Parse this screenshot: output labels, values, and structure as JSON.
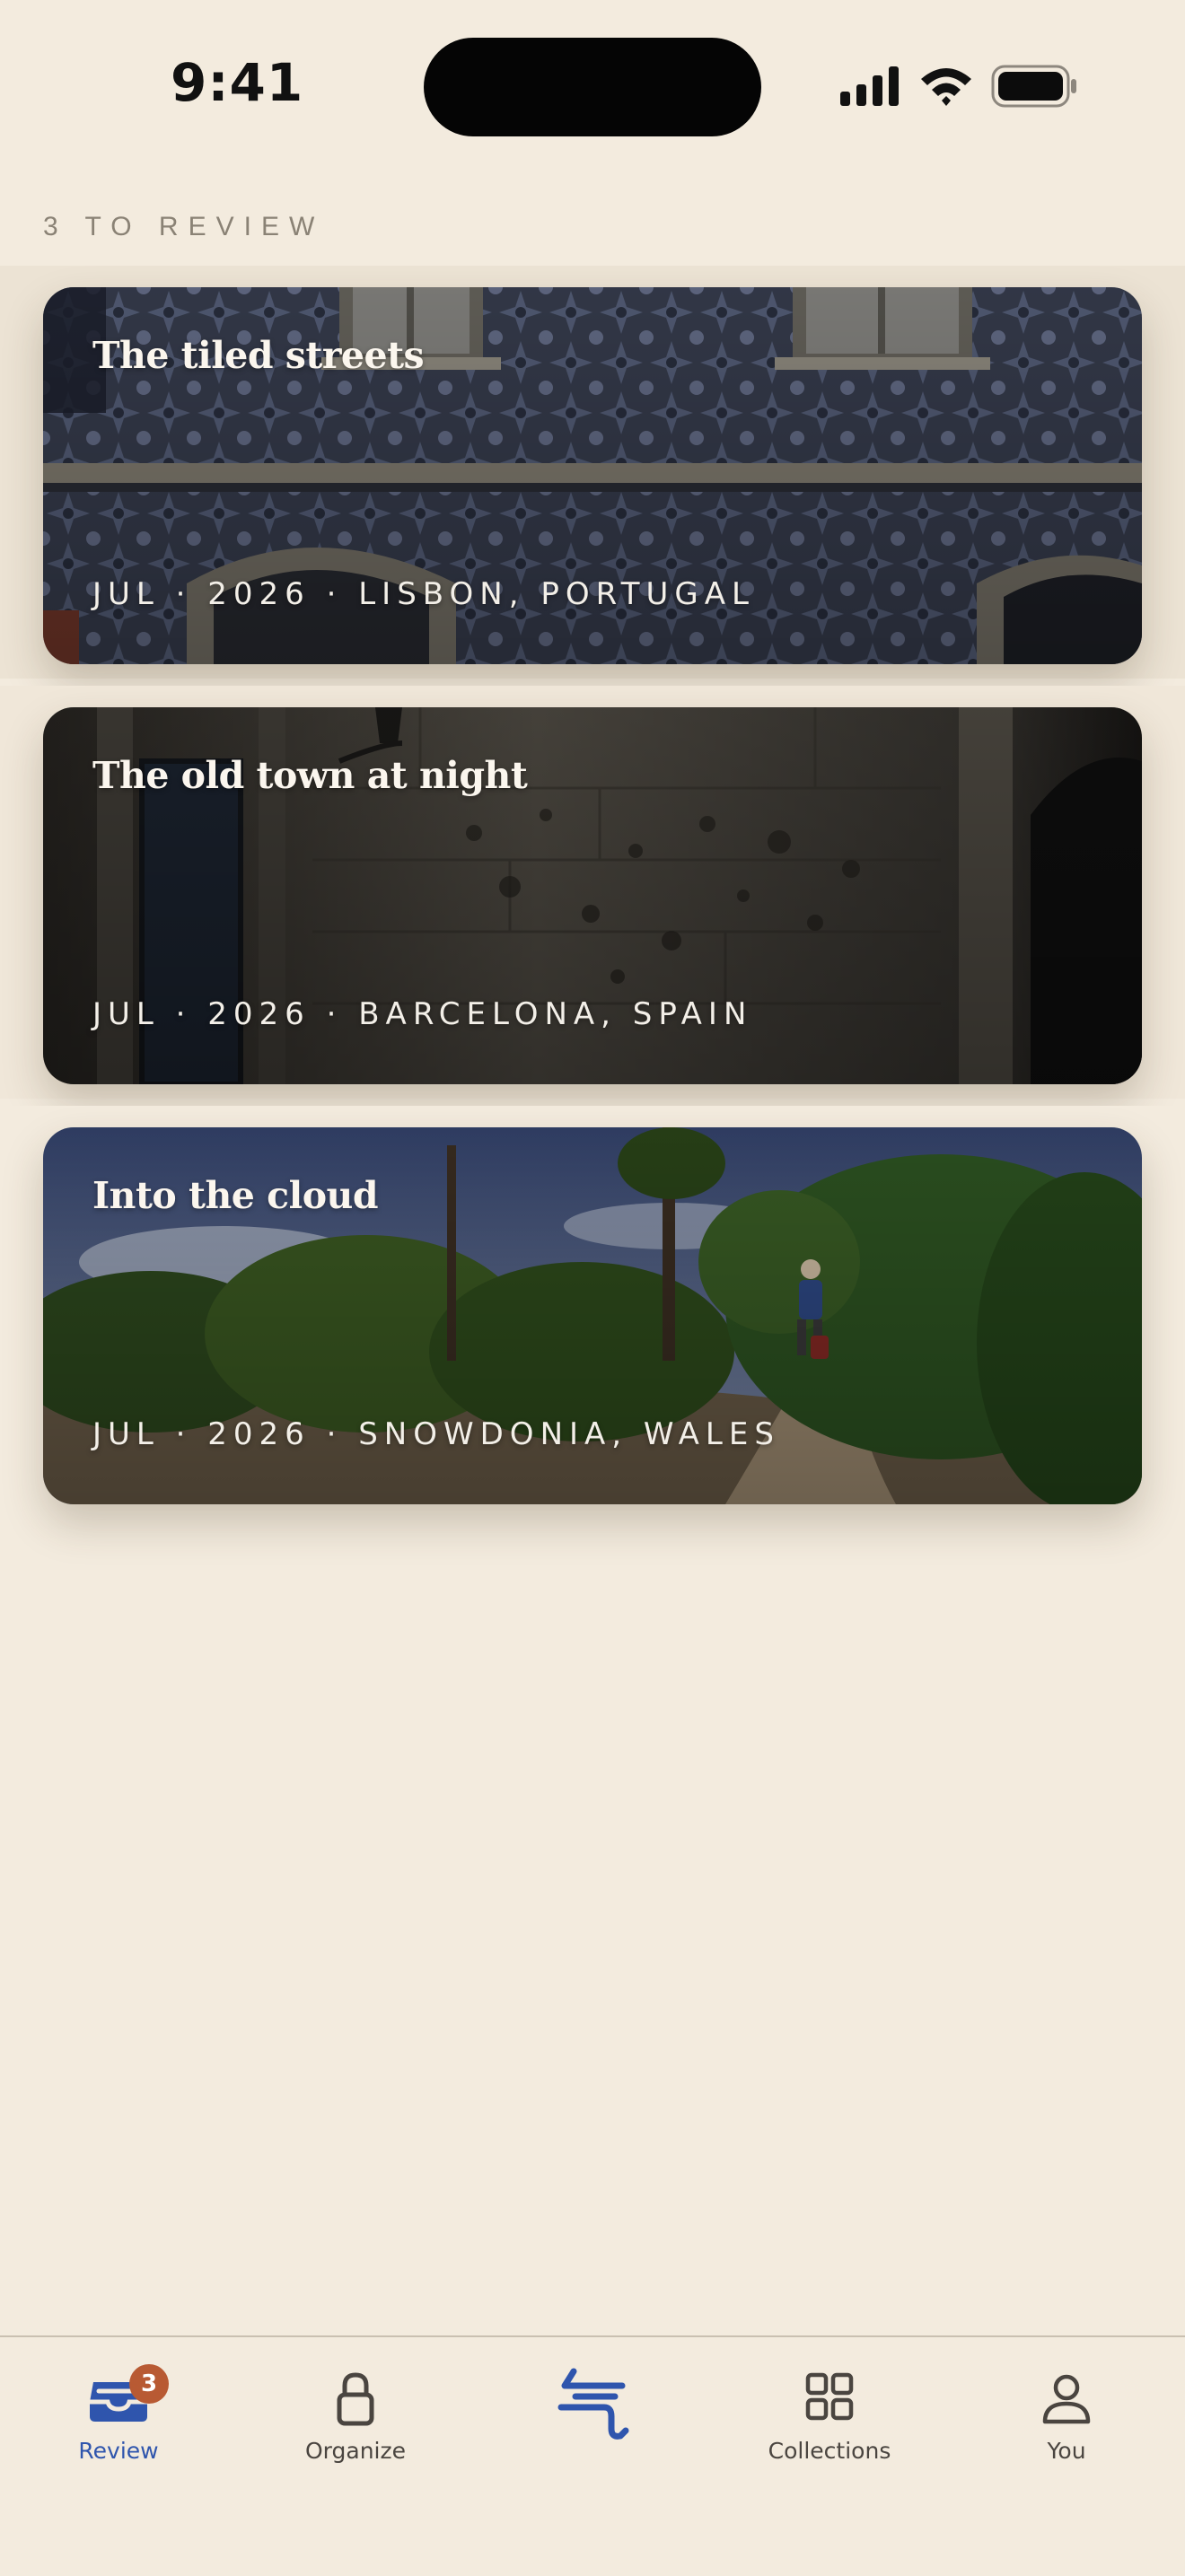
{
  "status_bar": {
    "time": "9:41"
  },
  "review": {
    "count_label": "3 TO REVIEW",
    "cards": [
      {
        "title": "The tiled streets",
        "meta": "JUL · 2026 · LISBON, PORTUGAL"
      },
      {
        "title": "The old town at night",
        "meta": "JUL · 2026 · BARCELONA, SPAIN"
      },
      {
        "title": "Into the cloud",
        "meta": "JUL · 2026 · SNOWDONIA, WALES"
      }
    ]
  },
  "tab_bar": {
    "active_tab": "Review",
    "accent_color": "#2f55ad",
    "badge_color": "#b85a33",
    "review": {
      "label": "Review",
      "icon": "inbox-tray-icon",
      "badge": "3"
    },
    "organize": {
      "label": "Organize",
      "icon": "lock-icon"
    },
    "center": {
      "icon": "app-logo-icon"
    },
    "collections": {
      "label": "Collections",
      "icon": "grid-icon"
    },
    "you": {
      "label": "You",
      "icon": "person-icon"
    }
  }
}
